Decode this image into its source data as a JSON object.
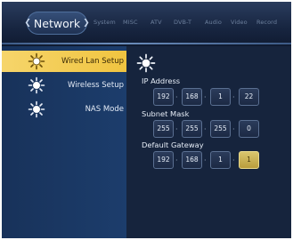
{
  "nav": {
    "current": "Network",
    "prev_icon": "chevron-left-icon",
    "next_icon": "chevron-right-icon",
    "tabs": [
      "System",
      "MISC",
      "ATV",
      "DVB-T",
      "Audio",
      "Video",
      "Record"
    ]
  },
  "menu": {
    "items": [
      {
        "label": "Wired Lan Setup",
        "icon": "settings-sun-icon",
        "selected": true
      },
      {
        "label": "Wireless Setup",
        "icon": "settings-sun-icon",
        "selected": false
      },
      {
        "label": "NAS Mode",
        "icon": "settings-sun-icon",
        "selected": false
      }
    ]
  },
  "settings": {
    "icon": "settings-sun-icon",
    "ip_address": {
      "label": "IP Address",
      "octets": [
        "192",
        "168",
        "1",
        "22"
      ]
    },
    "subnet_mask": {
      "label": "Subnet Mask",
      "octets": [
        "255",
        "255",
        "255",
        "0"
      ]
    },
    "default_gateway": {
      "label": "Default Gateway",
      "octets": [
        "192",
        "168",
        "1",
        "1"
      ],
      "active_index": 3
    }
  },
  "colors": {
    "selection": "#f0c440",
    "background": "#16243d",
    "panel": "#1c3d6c",
    "active_field": "#d9c66e"
  }
}
